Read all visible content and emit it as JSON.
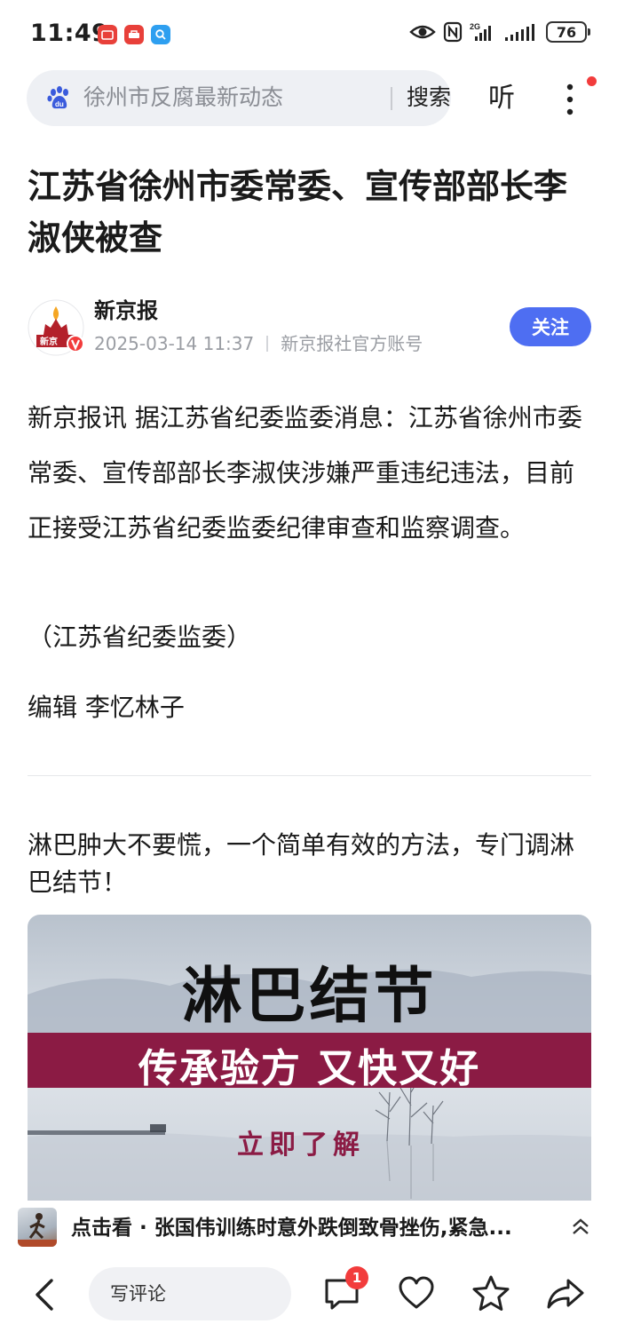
{
  "status_bar": {
    "time": "11:49",
    "battery": "76"
  },
  "search": {
    "query": "徐州市反腐最新动态",
    "button": "搜索"
  },
  "header": {
    "listen": "听"
  },
  "article": {
    "title": "江苏省徐州市委常委、宣传部部长李淑侠被查",
    "author": "新京报",
    "date": "2025-03-14 11:37",
    "account": "新京报社官方账号",
    "follow": "关注",
    "body": "新京报讯 据江苏省纪委监委消息：江苏省徐州市委常委、宣传部部长李淑侠涉嫌严重违纪违法，目前正接受江苏省纪委监委纪律审查和监察调查。",
    "source": "（江苏省纪委监委）",
    "editor": "编辑 李忆林子"
  },
  "ad": {
    "text": "淋巴肿大不要慌，一个简单有效的方法，专门调淋巴结节！",
    "headline": "淋巴结节",
    "band": "传承验方 又快又好",
    "cta": "立即了解"
  },
  "now_playing": {
    "text": "点击看 · 张国伟训练时意外跌倒致骨挫伤,紧急..."
  },
  "bottom_bar": {
    "comment_placeholder": "写评论",
    "comment_count": "1"
  },
  "colors": {
    "accent": "#4e6ef2",
    "badge": "#f23c3c",
    "ad_band": "#8b1b44"
  }
}
